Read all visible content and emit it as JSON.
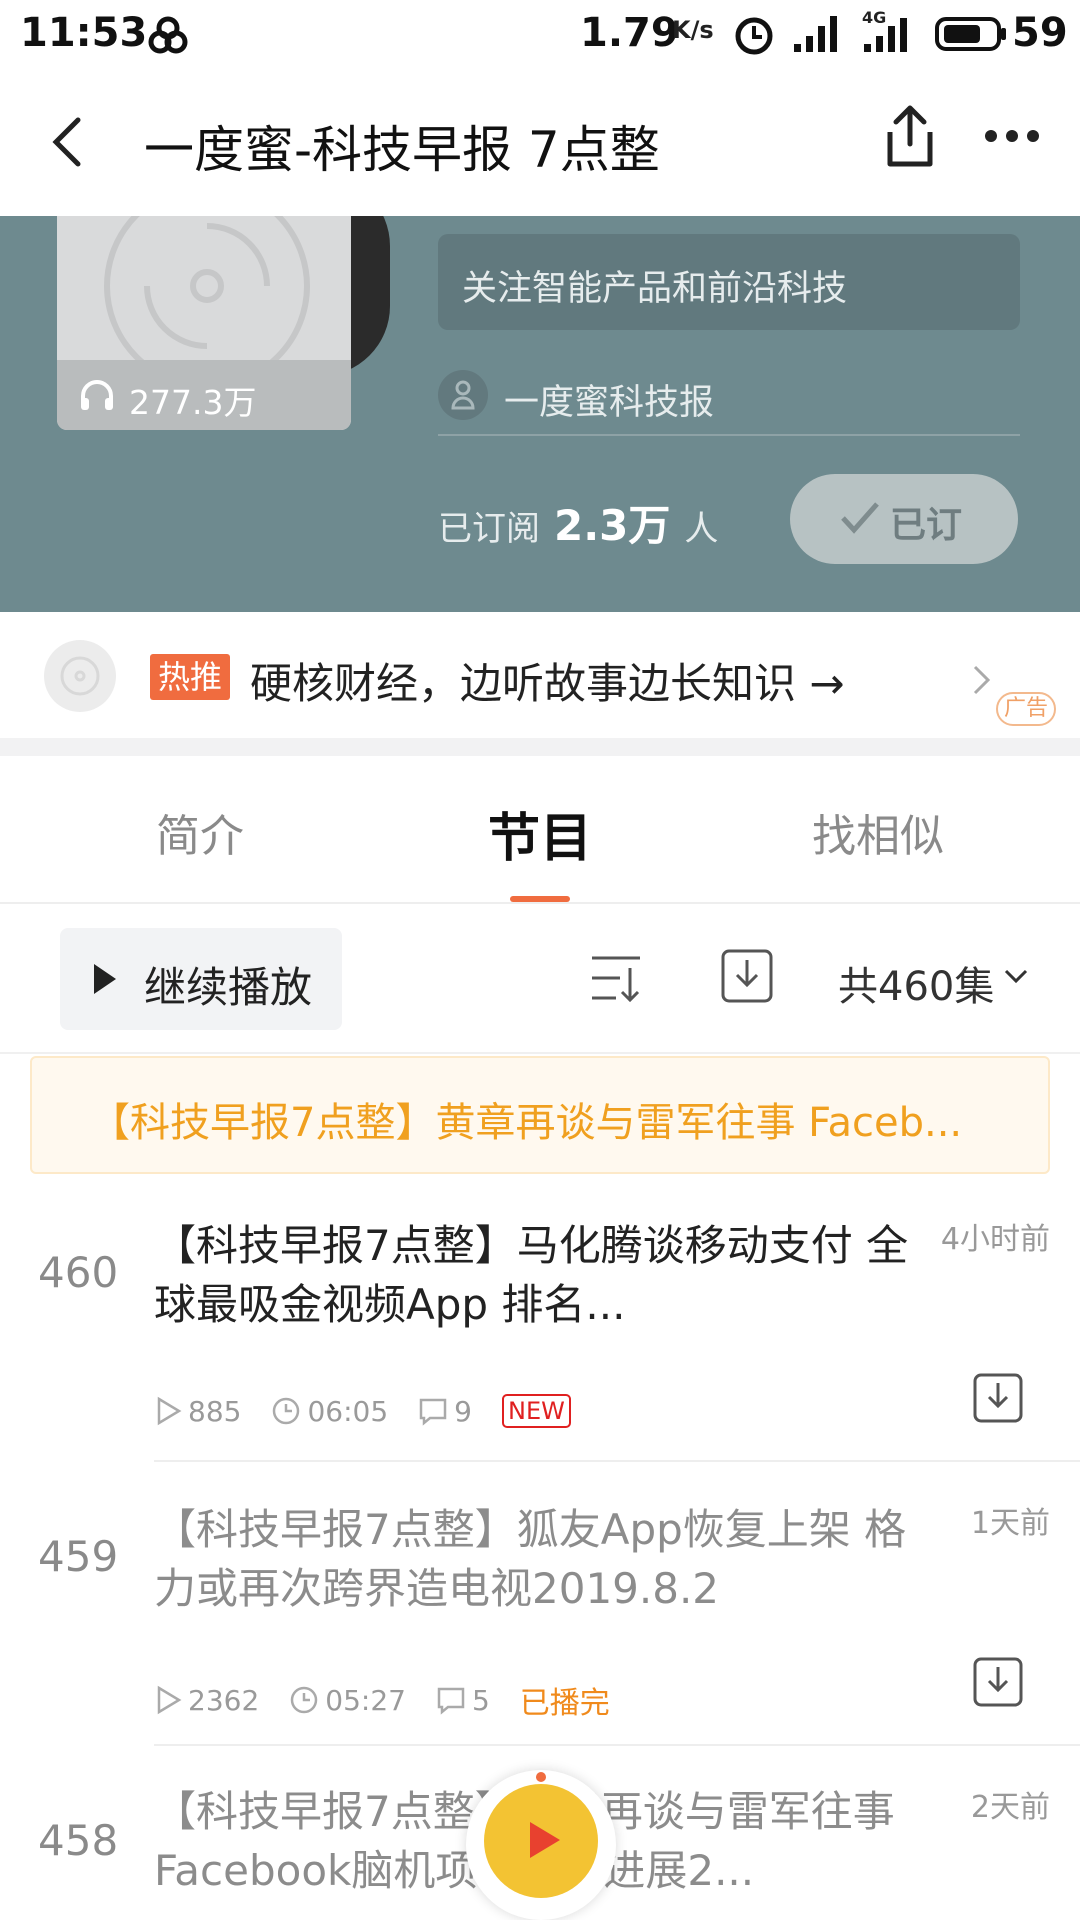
{
  "status_bar": {
    "time": "11:53",
    "speed": "1.79",
    "speed_unit": "K/s",
    "network": "4G",
    "battery": "59"
  },
  "header": {
    "title": "一度蜜-科技早报 7点整"
  },
  "podcast": {
    "play_count": "277.3万",
    "description": "关注智能产品和前沿科技",
    "author": "一度蜜科技报",
    "subscribed_prefix": "已订阅",
    "subscriber_count": "2.3万",
    "subscribed_suffix": "人",
    "subscribe_button": "已订"
  },
  "ad": {
    "badge": "热推",
    "text": "硬核财经，边听故事边长知识 →",
    "label": "广告"
  },
  "tabs": [
    {
      "label": "简介"
    },
    {
      "label": "节目"
    },
    {
      "label": "找相似"
    }
  ],
  "toolbar": {
    "continue_label": "继续播放",
    "count_label": "共460集"
  },
  "notice": {
    "text": "【科技早报7点整】黄章再谈与雷军往事 Faceb..."
  },
  "episodes": [
    {
      "number": "460",
      "title": "【科技早报7点整】马化腾谈移动支付 全球最吸金视频App 排名...",
      "time": "4小时前",
      "plays": "885",
      "duration": "06:05",
      "comments": "9",
      "status": "NEW"
    },
    {
      "number": "459",
      "title": "【科技早报7点整】狐友App恢复上架 格力或再次跨界造电视2019.8.2",
      "time": "1天前",
      "plays": "2362",
      "duration": "05:27",
      "comments": "5",
      "status": "已播完"
    },
    {
      "number": "458",
      "title": "【科技早报7点整】黄章再谈与雷军往事 Facebook脑机项目取得进展2...",
      "time": "2天前"
    }
  ],
  "colors": {
    "accent": "#f06c3f",
    "hero_bg": "#6e8a8f",
    "played": "#f08a1c",
    "new_badge": "#e02020"
  }
}
